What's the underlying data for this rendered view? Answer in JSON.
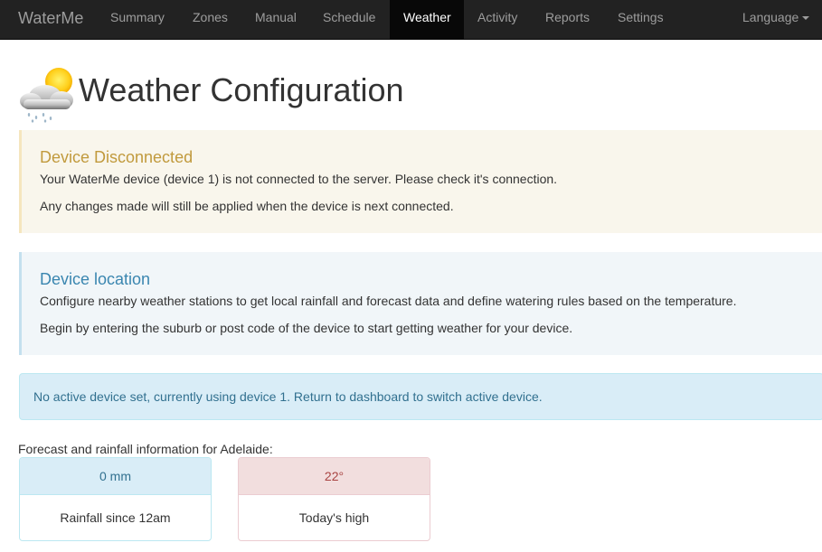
{
  "navbar": {
    "brand": "WaterMe",
    "items": [
      {
        "label": "Summary"
      },
      {
        "label": "Zones"
      },
      {
        "label": "Manual"
      },
      {
        "label": "Schedule"
      },
      {
        "label": "Weather"
      },
      {
        "label": "Activity"
      },
      {
        "label": "Reports"
      },
      {
        "label": "Settings"
      }
    ],
    "active_item": "Weather",
    "language_label": "Language"
  },
  "header": {
    "title": "Weather Configuration",
    "icon": "cloud-sun-rain-icon"
  },
  "disconnected_callout": {
    "title": "Device Disconnected",
    "line1": "Your WaterMe device (device 1) is not connected to the server. Please check it's connection.",
    "line2": "Any changes made will still be applied when the device is next connected."
  },
  "location_callout": {
    "title": "Device location",
    "line1": "Configure nearby weather stations to get local rainfall and forecast data and define watering rules based on the temperature.",
    "line2": "Begin by entering the suburb or post code of the device to start getting weather for your device."
  },
  "alert": {
    "text": "No active device set, currently using device 1. Return to dashboard to switch active device."
  },
  "forecast": {
    "label": "Forecast and rainfall information for Adelaide:",
    "rainfall": {
      "value": "0 mm",
      "caption": "Rainfall since 12am"
    },
    "temperature": {
      "value": "22°",
      "caption": "Today's high"
    }
  },
  "colors": {
    "navbar_bg": "#222222",
    "active_nav_bg": "#080808",
    "warning_title": "#c19a3d",
    "info_title": "#3a86b0",
    "alert_info_bg": "#d9edf7",
    "danger_heading_bg": "#f2dede"
  }
}
